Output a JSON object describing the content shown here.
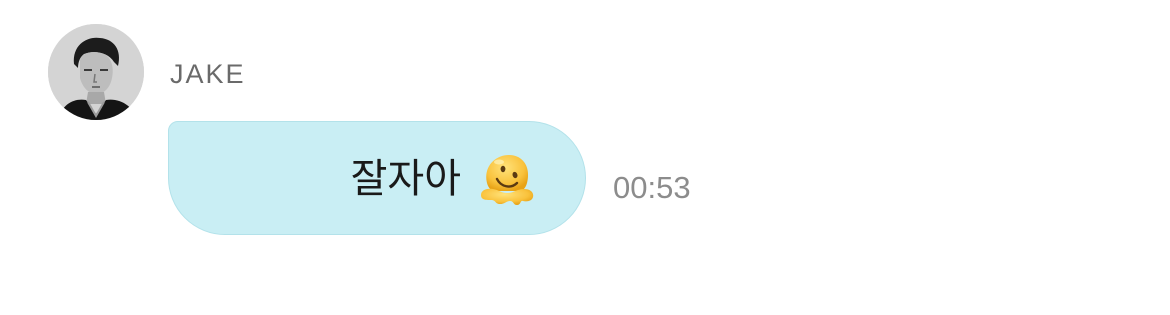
{
  "message": {
    "sender": {
      "name": "JAKE",
      "avatar_icon": "profile-photo"
    },
    "text": "잘자아",
    "emoji_icon": "melting-face-emoji",
    "timestamp": "00:53"
  },
  "colors": {
    "background": "#ffffff",
    "bubble_fill": "#c9eef4",
    "bubble_border": "#b3e2ea",
    "name_text": "#6a6a6a",
    "message_text": "#1a1a1a",
    "timestamp_text": "#8c8c8c"
  }
}
